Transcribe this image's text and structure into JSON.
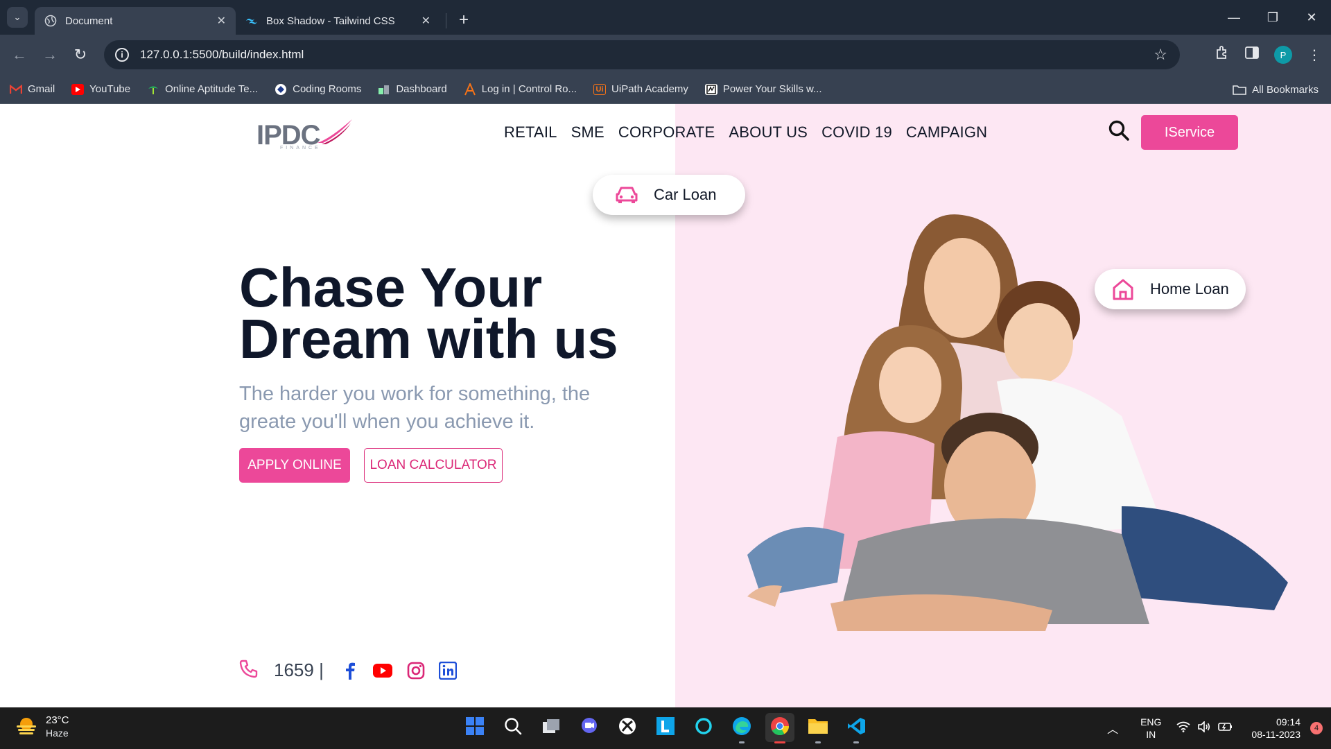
{
  "browser": {
    "tabs": [
      {
        "title": "Document",
        "active": true
      },
      {
        "title": "Box Shadow - Tailwind CSS",
        "active": false
      }
    ],
    "url": "127.0.0.1:5500/build/index.html",
    "profile_initial": "P",
    "bookmarks": [
      {
        "label": "Gmail",
        "icon": "gmail-icon",
        "color": "#ea4335"
      },
      {
        "label": "YouTube",
        "icon": "youtube-icon",
        "color": "#ff0000"
      },
      {
        "label": "Online Aptitude Te...",
        "icon": "aptitude-icon",
        "color": "#22c55e"
      },
      {
        "label": "Coding Rooms",
        "icon": "coding-rooms-icon",
        "color": "#ffffff"
      },
      {
        "label": "Dashboard",
        "icon": "dashboard-icon",
        "color": "#86efac"
      },
      {
        "label": "Log in | Control Ro...",
        "icon": "control-room-icon",
        "color": "#f97316"
      },
      {
        "label": "UiPath Academy",
        "icon": "uipath-icon",
        "color": "#f97316"
      },
      {
        "label": "Power Your Skills w...",
        "icon": "skills-icon",
        "color": "#ffffff"
      }
    ],
    "all_bookmarks": "All Bookmarks"
  },
  "site": {
    "logo_text": "IPDC",
    "logo_sub": "FINANCE",
    "nav": [
      "RETAIL",
      "SME",
      "CORPORATE",
      "ABOUT US",
      "COVID 19",
      "CAMPAIGN"
    ],
    "iservice": "IService",
    "car_loan": "Car Loan",
    "home_loan": "Home Loan",
    "hero_line1": "Chase Your",
    "hero_line2": "Dream with us",
    "hero_sub": "The harder you work for something, the greate you'll when you achieve it.",
    "apply": "APPLY ONLINE",
    "calculator": "LOAN CALCULATOR",
    "phone": "1659 |",
    "accent": "#ec4899"
  },
  "taskbar": {
    "temp": "23°C",
    "weather": "Haze",
    "lang1": "ENG",
    "lang2": "IN",
    "time": "09:14",
    "date": "08-11-2023",
    "notifications": "4"
  }
}
